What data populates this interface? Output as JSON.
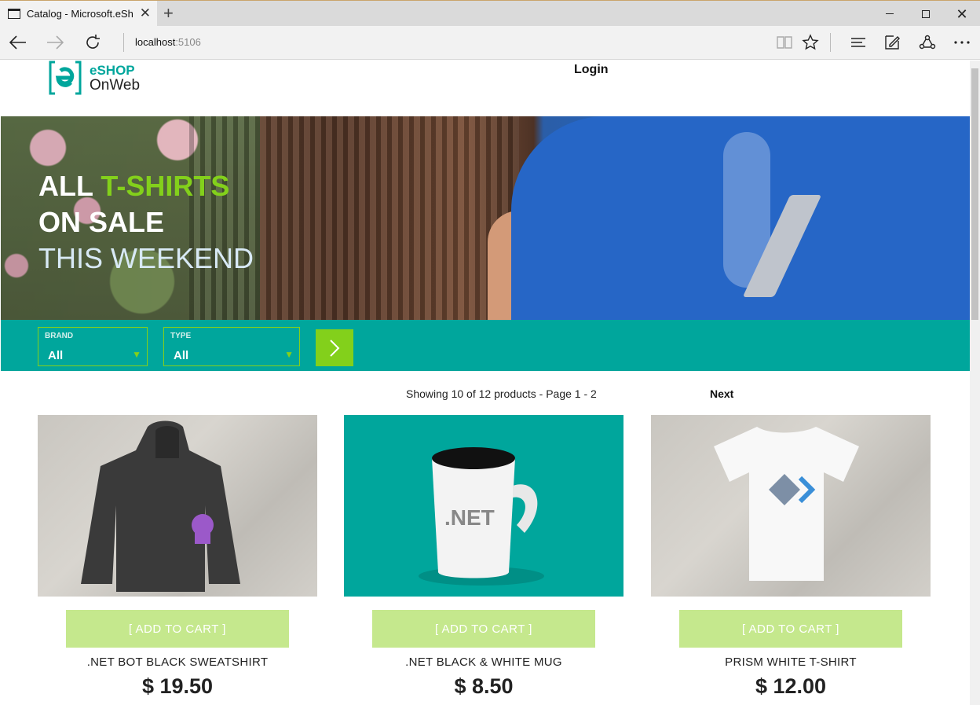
{
  "browser": {
    "tab_title": "Catalog - Microsoft.eSh",
    "url_host": "localhost",
    "url_port": ":5106"
  },
  "header": {
    "logo_line1": "eSHOP",
    "logo_line2": "OnWeb",
    "login": "Login"
  },
  "hero": {
    "line1_a": "ALL",
    "line1_b": "T-SHIRTS",
    "line2": "ON SALE",
    "line3": "THIS WEEKEND"
  },
  "filters": {
    "brand_label": "BRAND",
    "brand_value": "All",
    "type_label": "TYPE",
    "type_value": "All"
  },
  "pager": {
    "info": "Showing 10 of 12 products - Page 1 - 2",
    "next": "Next"
  },
  "products": [
    {
      "add_label": "[ ADD TO CART ]",
      "name": ".NET BOT BLACK SWEATSHIRT",
      "price": "$ 19.50"
    },
    {
      "add_label": "[ ADD TO CART ]",
      "name": ".NET BLACK & WHITE MUG",
      "price": "$ 8.50"
    },
    {
      "add_label": "[ ADD TO CART ]",
      "name": "PRISM WHITE T-SHIRT",
      "price": "$ 12.00"
    }
  ],
  "mug_text": ".NET",
  "colors": {
    "brand_teal": "#00a69c",
    "brand_green": "#83d01b",
    "cart_button": "#c5e88d"
  }
}
